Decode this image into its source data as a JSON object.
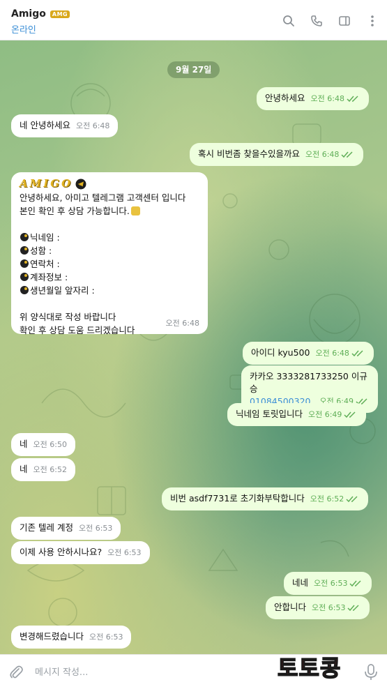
{
  "header": {
    "chat_name": "Amigo",
    "name_badge": "AMG",
    "status": "온라인",
    "icons": [
      "search-icon",
      "phone-icon",
      "sidebar-icon",
      "more-icon"
    ]
  },
  "chat": {
    "date_chip": "9월 27일",
    "messages": [
      {
        "dir": "out",
        "text": "안녕하세요",
        "time": "오전 6:48"
      },
      {
        "dir": "in",
        "text": "네 안녕하세요",
        "time": "오전 6:48"
      },
      {
        "dir": "out",
        "text": "혹시 비번좀 찾을수있을까요",
        "time": "오전 6:48"
      },
      {
        "dir": "out",
        "text": "아이디 kyu500",
        "time": "오전 6:48"
      },
      {
        "dir": "out",
        "text": "카카오 3333281733250 이규승",
        "link": "01084500320",
        "time": "오전 6:49"
      },
      {
        "dir": "out",
        "text": "닉네임 토릿입니다",
        "time": "오전 6:49"
      },
      {
        "dir": "in",
        "text": "네",
        "time": "오전 6:50"
      },
      {
        "dir": "in",
        "text": "네",
        "time": "오전 6:52"
      },
      {
        "dir": "out",
        "text": "비번 asdf7731로 초기화부탁합니다",
        "time": "오전 6:52"
      },
      {
        "dir": "in",
        "text": "기존 텔레 계정",
        "time": "오전 6:53"
      },
      {
        "dir": "in",
        "text": "이제 사용 안하시나요?",
        "time": "오전 6:53"
      },
      {
        "dir": "out",
        "text": "네네",
        "time": "오전 6:53"
      },
      {
        "dir": "out",
        "text": "안합니다",
        "time": "오전 6:53"
      },
      {
        "dir": "in",
        "text": "변경해드렸습니다",
        "time": "오전 6:53"
      }
    ],
    "form_message": {
      "logo_text": "AMIGO",
      "line1": "안녕하세요, 아미고 텔레그램 고객센터 입니다",
      "line2": "본인 확인 후 상담 가능합니다.",
      "fields": [
        "닉네임 :",
        "성함 :",
        "연락처 :",
        "계좌정보 :",
        "생년월일 앞자리 :"
      ],
      "footer1": "위 양식대로 작성 바랍니다",
      "footer2": "확인 후 상담 도움 드리겠습니다",
      "time": "오전 6:48"
    }
  },
  "composer": {
    "placeholder": "메시지 작성...",
    "value": ""
  },
  "watermark": "토토콩",
  "colors": {
    "accent": "#3a8ed6",
    "out_bubble": "#eeffde",
    "in_bubble": "#ffffff",
    "out_meta": "#5fae57"
  }
}
